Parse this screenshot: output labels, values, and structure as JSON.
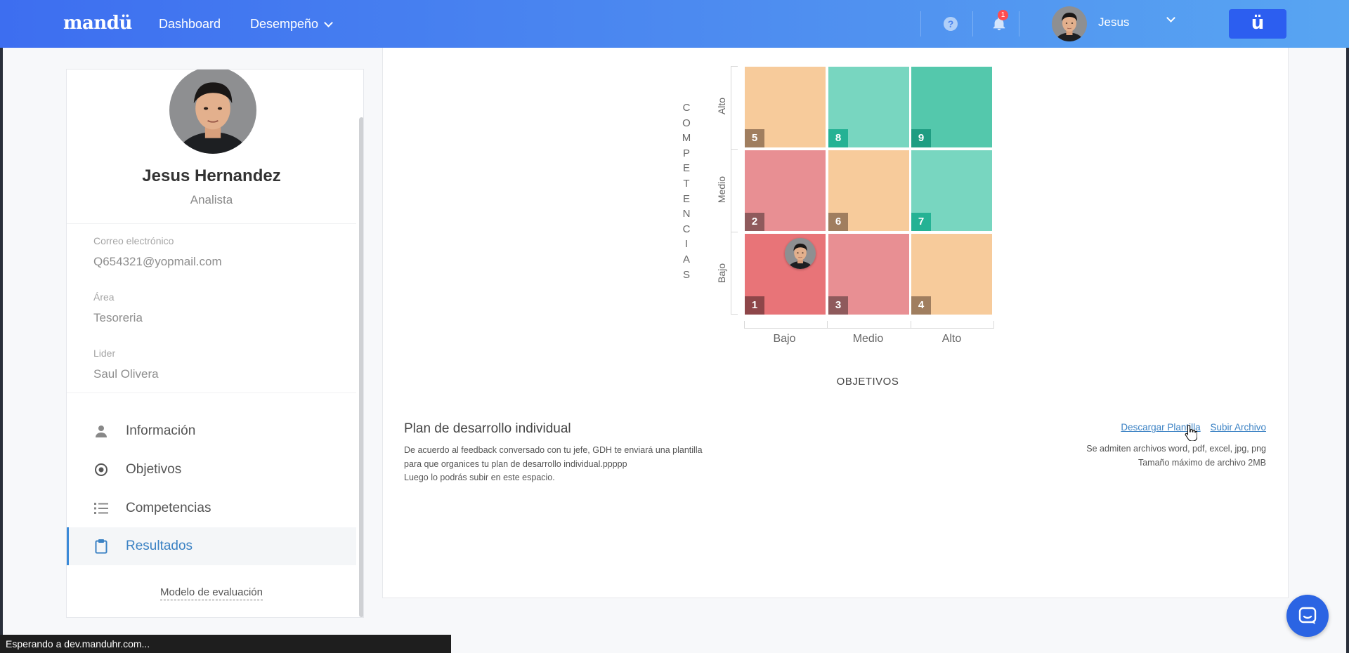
{
  "topbar": {
    "logo": "mandü",
    "nav_dashboard": "Dashboard",
    "nav_performance": "Desempeño",
    "help_glyph": "?",
    "notification_count": "1",
    "username": "Jesus",
    "brand_button": "ü"
  },
  "profile": {
    "name": "Jesus Hernandez",
    "role": "Analista",
    "email_label": "Correo electrónico",
    "email": "Q654321@yopmail.com",
    "area_label": "Área",
    "area": "Tesoreria",
    "leader_label": "Lider",
    "leader": "Saul Olivera"
  },
  "menu": {
    "items": [
      {
        "label": "Información",
        "icon": "user-icon"
      },
      {
        "label": "Objetivos",
        "icon": "target-icon"
      },
      {
        "label": "Competencias",
        "icon": "list-icon"
      },
      {
        "label": "Resultados",
        "icon": "clipboard-icon",
        "active": true
      }
    ],
    "model_link": "Modelo de evaluación"
  },
  "matrix": {
    "y_title_letters": [
      "C",
      "O",
      "M",
      "P",
      "E",
      "T",
      "E",
      "N",
      "C",
      "I",
      "A",
      "S"
    ],
    "row_labels": [
      "Alto",
      "Medio",
      "Bajo"
    ],
    "col_labels": [
      "Bajo",
      "Medio",
      "Alto"
    ],
    "x_title": "OBJETIVOS",
    "cells": [
      {
        "num": "5",
        "color": "#f7cb9b",
        "badge": "#a07e5f"
      },
      {
        "num": "8",
        "color": "#78d6c0",
        "badge": "#24b294"
      },
      {
        "num": "9",
        "color": "#54c8ac",
        "badge": "#1f9d82"
      },
      {
        "num": "2",
        "color": "#e88f93",
        "badge": "#8f5a5c"
      },
      {
        "num": "6",
        "color": "#f7cb9b",
        "badge": "#a07e5f"
      },
      {
        "num": "7",
        "color": "#78d6c0",
        "badge": "#24b294"
      },
      {
        "num": "1",
        "color": "#e87478",
        "badge": "#8e4649",
        "has_employee": true
      },
      {
        "num": "3",
        "color": "#e88f93",
        "badge": "#8f5a5c"
      },
      {
        "num": "4",
        "color": "#f7cb9b",
        "badge": "#a07e5f"
      }
    ]
  },
  "plan": {
    "title": "Plan de desarrollo individual",
    "desc_line1": "De acuerdo al feedback conversado con tu jefe, GDH te enviará una plantilla",
    "desc_line2": "para que organices tu plan de desarrollo individual.ppppp",
    "desc_line3": "Luego lo podrás subir en este espacio.",
    "download_link": "Descargar Plantilla",
    "upload_link": "Subir Archivo",
    "note_line1": "Se admiten archivos word, pdf, excel, jpg, png",
    "note_line2": "Tamaño máximo de archivo 2MB"
  },
  "status_bar": "Esperando a dev.manduhr.com..."
}
